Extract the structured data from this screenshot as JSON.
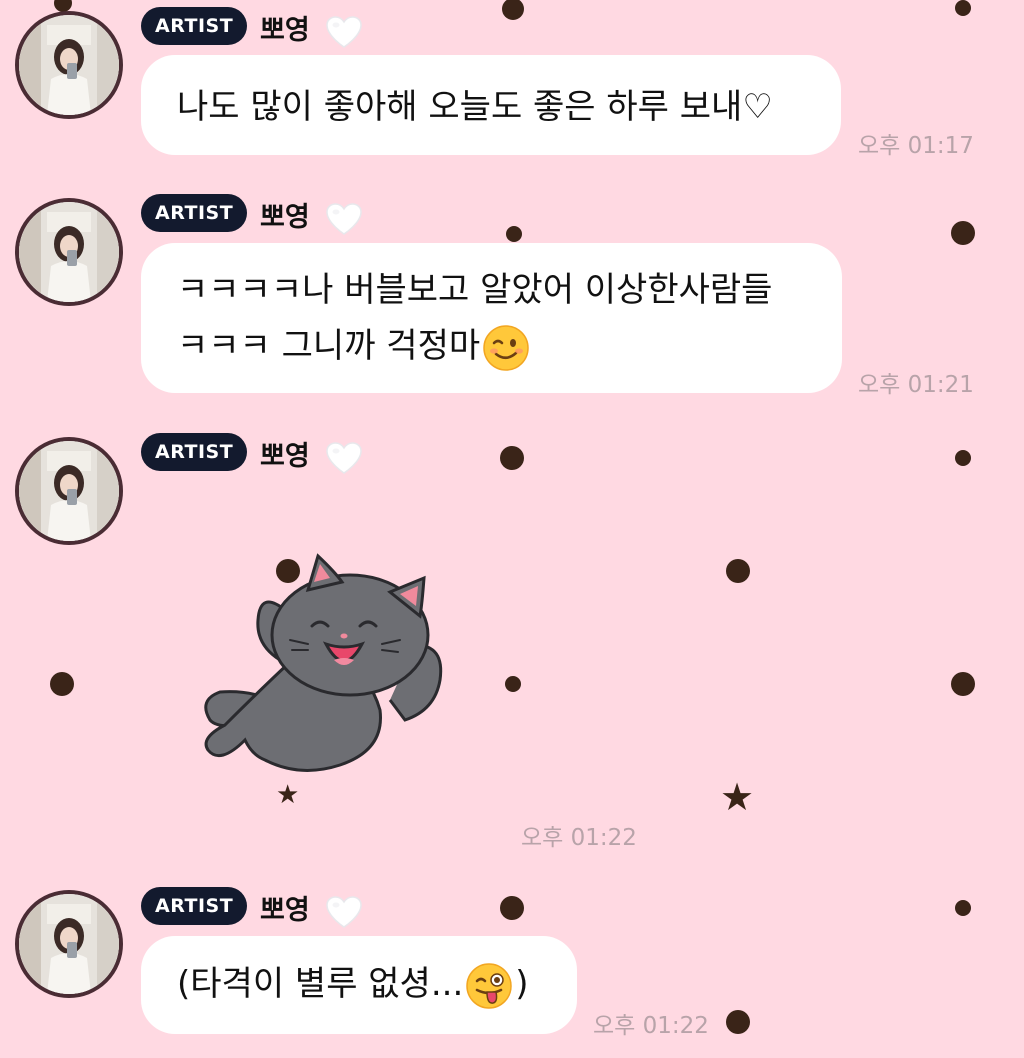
{
  "messages": [
    {
      "badge": "ARTIST",
      "sender": "뽀영",
      "text": "나도 많이 좋아해 오늘도 좋은 하루 보내♡",
      "time": "오후 01:17"
    },
    {
      "badge": "ARTIST",
      "sender": "뽀영",
      "text_line1": "ㅋㅋㅋㅋ나 버블보고 알았어 이상한사람들",
      "text_line2": "ㅋㅋㅋ 그니까 걱정마",
      "emoji": "winking-face",
      "time": "오후 01:21"
    },
    {
      "badge": "ARTIST",
      "sender": "뽀영",
      "sticker": "gray-cat-sticker",
      "time": "오후 01:22"
    },
    {
      "badge": "ARTIST",
      "sender": "뽀영",
      "text": "(타격이 별루 없셩...",
      "emoji": "winking-tongue-face",
      "text_end": ")",
      "time": "오후 01:22"
    }
  ],
  "colors": {
    "background": "#ffd9e2",
    "dot": "#3a2418",
    "badge": "#131a2e",
    "bubble": "#ffffff",
    "time": "#b8a3a9"
  }
}
